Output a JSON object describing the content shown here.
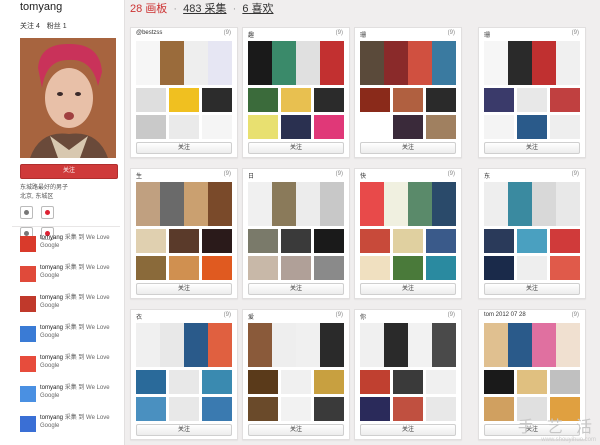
{
  "profile": {
    "username": "tomyang",
    "following_label": "关注 4",
    "followers_label": "粉丝 1",
    "follow_button": "关注",
    "bio_line1": "东城路最好的男子",
    "bio_line2": "北京, 东城区",
    "social_icons": [
      "sina-weibo-icon",
      "qq-weibo-icon",
      "douban-icon",
      "tencent-icon"
    ]
  },
  "activity": [
    {
      "user": "tomyang",
      "action": "采集 到 We Love Google",
      "thumb_color": "#d93a2b"
    },
    {
      "user": "tomyang",
      "action": "采集 到 We Love Google",
      "thumb_color": "#e04a3a"
    },
    {
      "user": "tomyang",
      "action": "采集 到 We Love Google",
      "thumb_color": "#c0392b"
    },
    {
      "user": "tomyang",
      "action": "采集 到 We Love Google",
      "thumb_color": "#3a7bd5"
    },
    {
      "user": "tomyang",
      "action": "采集 到 We Love Google",
      "thumb_color": "#e74c3c"
    },
    {
      "user": "tomyang",
      "action": "采集 到 We Love Google",
      "thumb_color": "#4a90e2"
    },
    {
      "user": "tomyang",
      "action": "采集 到 We Love Google",
      "thumb_color": "#3a6fd5"
    }
  ],
  "header": {
    "boards_num": "28",
    "boards_label": "画板",
    "pins_num": "483",
    "pins_label": "采集",
    "likes_num": "6",
    "likes_label": "喜欢",
    "sep": "·"
  },
  "boards": [
    {
      "title": "@bestzss",
      "count": "(9)",
      "follow": "关注",
      "cover": [
        "#f6f6f6",
        "#9a6b3b",
        "#eeeeee",
        "#e6e6f3"
      ],
      "thumbs": [
        "#dedede",
        "#f0c020",
        "#2c2c2c",
        "#c9c9c9",
        "#eaeaea",
        "#f5f5f5"
      ]
    },
    {
      "title": "趣",
      "count": "(9)",
      "follow": "关注",
      "cover": [
        "#1a1a1a",
        "#3a8a6a",
        "#e0e0e0",
        "#c23030"
      ],
      "thumbs": [
        "#3b6b3b",
        "#e8c050",
        "#2b2b2b",
        "#e8e070",
        "#2a3050",
        "#e03878"
      ]
    },
    {
      "title": "珊",
      "count": "(9)",
      "follow": "关注",
      "cover": [
        "#5a4a3a",
        "#8a2a2a",
        "#d05040",
        "#3a7aa0"
      ],
      "thumbs": [
        "#8a2a1a",
        "#b06040",
        "#2a2a2a",
        "#ffffff",
        "#3a2a3a",
        "#a08060"
      ]
    },
    {
      "title": "珊",
      "count": "(9)",
      "follow": "关注",
      "cover": [
        "#f6f6f6",
        "#2a2a2a",
        "#c03030",
        "#f0f0f0"
      ],
      "thumbs": [
        "#3a3a6a",
        "#e8e8e8",
        "#c04040",
        "#f4f4f4",
        "#2a5a8a",
        "#eeeeee"
      ]
    },
    {
      "title": "生",
      "count": "(9)",
      "follow": "关注",
      "cover": [
        "#c0a080",
        "#6a6a6a",
        "#caa070",
        "#7a4a2a"
      ],
      "thumbs": [
        "#e0d0b0",
        "#5a3a2a",
        "#2a1a1a",
        "#8a6a3a",
        "#d09050",
        "#e05a20"
      ]
    },
    {
      "title": "日",
      "count": "(9)",
      "follow": "关注",
      "cover": [
        "#f0f0f0",
        "#8a7a5a",
        "#ececec",
        "#c8c8c8"
      ],
      "thumbs": [
        "#7a7a6a",
        "#3a3a3a",
        "#1a1a1a",
        "#c8b8a8",
        "#b0a098",
        "#8a8a8a"
      ]
    },
    {
      "title": "快",
      "count": "(9)",
      "follow": "关注",
      "cover": [
        "#e84a4a",
        "#f0f0e0",
        "#5a8a6a",
        "#2a4a6a"
      ],
      "thumbs": [
        "#c84a3a",
        "#e0d0a0",
        "#3a5a8a",
        "#f0e0c0",
        "#4a7a3a",
        "#2a8aa0"
      ]
    },
    {
      "title": "东",
      "count": "(9)",
      "follow": "关注",
      "cover": [
        "#eeeeee",
        "#3a8aa0",
        "#d8d8d8",
        "#e8e8e8"
      ],
      "thumbs": [
        "#2a3a5a",
        "#4aa0c0",
        "#d03a3a",
        "#1a2a4a",
        "#eeeeee",
        "#e05a4a"
      ]
    },
    {
      "title": "衣",
      "count": "(9)",
      "follow": "关注",
      "cover": [
        "#f0f0f0",
        "#e8e8e8",
        "#2a5a8a",
        "#e06040"
      ],
      "thumbs": [
        "#2a6a9a",
        "#e8e8e8",
        "#3a8ab0",
        "#4a90c0",
        "#e8e8e8",
        "#3a7ab0"
      ]
    },
    {
      "title": "爱",
      "count": "(9)",
      "follow": "关注",
      "cover": [
        "#8a5a3a",
        "#eeeeee",
        "#f0f0f0",
        "#2a2a2a"
      ],
      "thumbs": [
        "#5a3a1a",
        "#f0f0f0",
        "#c8a040",
        "#6a4a2a",
        "#f2f2f2",
        "#3a3a3a"
      ]
    },
    {
      "title": "你",
      "count": "(9)",
      "follow": "关注",
      "cover": [
        "#f0f0f0",
        "#2a2a2a",
        "#f2f2f2",
        "#4a4a4a"
      ],
      "thumbs": [
        "#c04030",
        "#3a3a3a",
        "#f0f0f0",
        "#2a2a5a",
        "#c05040",
        "#e8e8e8"
      ]
    },
    {
      "title": "tom 2012 07 28",
      "count": "(9)",
      "follow": "关注",
      "cover": [
        "#e0c090",
        "#2a5a8a",
        "#e070a0",
        "#f0e0d0"
      ],
      "thumbs": [
        "#1a1a1a",
        "#e0c080",
        "#c0c0c0",
        "#d0a060",
        "#e0e0e0",
        "#e0a040"
      ]
    }
  ],
  "watermark": {
    "chars": "手 艺 活",
    "url": "www.shouyihuo.com"
  }
}
